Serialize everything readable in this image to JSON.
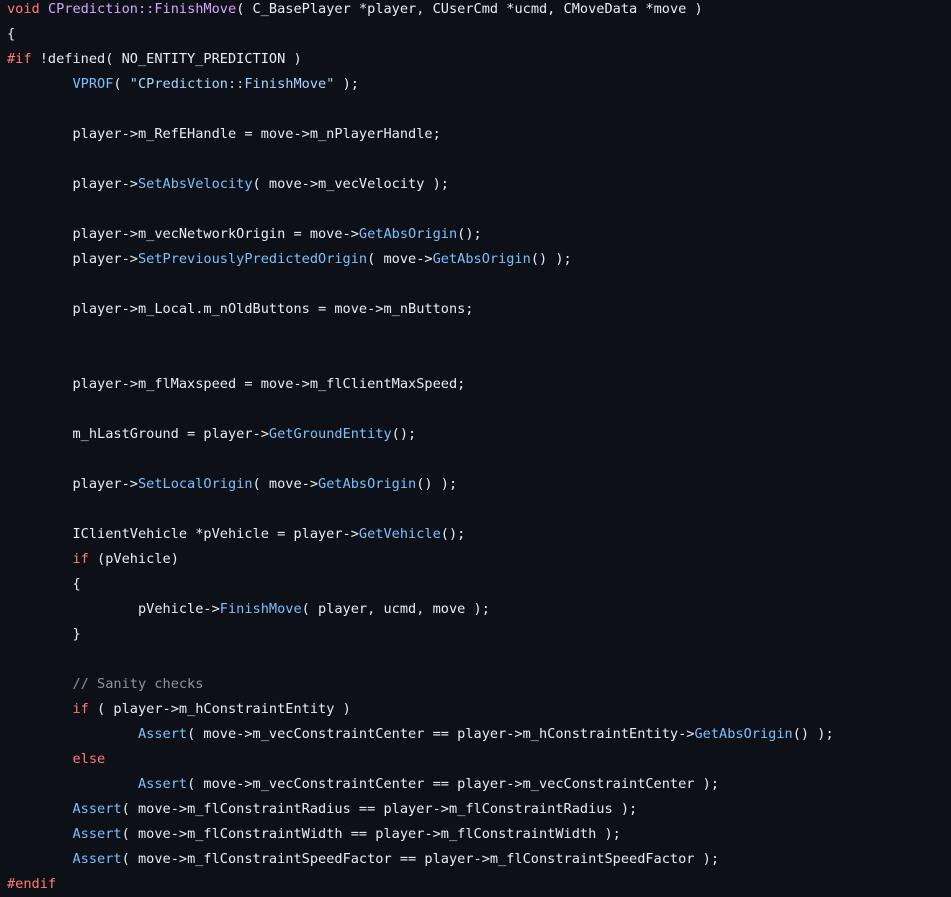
{
  "colors": {
    "background": "#0d1117",
    "text": "#e6edf3",
    "keyword": "#ff7b72",
    "function_def": "#d2a8ff",
    "function_call": "#79c0ff",
    "string": "#a5d6ff",
    "comment": "#8b949e"
  },
  "code_lines": [
    [
      [
        "kw",
        "void"
      ],
      [
        "plain",
        " "
      ],
      [
        "fn",
        "CPrediction::FinishMove"
      ],
      [
        "plain",
        "( C_BasePlayer *player, CUserCmd *ucmd, CMoveData *move )"
      ]
    ],
    [
      [
        "plain",
        "{"
      ]
    ],
    [
      [
        "pp",
        "#if"
      ],
      [
        "plain",
        " !defined( NO_ENTITY_PREDICTION )"
      ]
    ],
    [
      [
        "plain",
        "        "
      ],
      [
        "call",
        "VPROF"
      ],
      [
        "plain",
        "( "
      ],
      [
        "str",
        "\"CPrediction::FinishMove\""
      ],
      [
        "plain",
        " );"
      ]
    ],
    [],
    [
      [
        "plain",
        "        player->m_RefEHandle = move->m_nPlayerHandle;"
      ]
    ],
    [],
    [
      [
        "plain",
        "        player->"
      ],
      [
        "call",
        "SetAbsVelocity"
      ],
      [
        "plain",
        "( move->m_vecVelocity );"
      ]
    ],
    [],
    [
      [
        "plain",
        "        player->m_vecNetworkOrigin = move->"
      ],
      [
        "call",
        "GetAbsOrigin"
      ],
      [
        "plain",
        "();"
      ]
    ],
    [
      [
        "plain",
        "        player->"
      ],
      [
        "call",
        "SetPreviouslyPredictedOrigin"
      ],
      [
        "plain",
        "( move->"
      ],
      [
        "call",
        "GetAbsOrigin"
      ],
      [
        "plain",
        "() );"
      ]
    ],
    [],
    [
      [
        "plain",
        "        player->m_Local.m_nOldButtons = move->m_nButtons;"
      ]
    ],
    [],
    [],
    [
      [
        "plain",
        "        player->m_flMaxspeed = move->m_flClientMaxSpeed;"
      ]
    ],
    [],
    [
      [
        "plain",
        "        m_hLastGround = player->"
      ],
      [
        "call",
        "GetGroundEntity"
      ],
      [
        "plain",
        "();"
      ]
    ],
    [],
    [
      [
        "plain",
        "        player->"
      ],
      [
        "call",
        "SetLocalOrigin"
      ],
      [
        "plain",
        "( move->"
      ],
      [
        "call",
        "GetAbsOrigin"
      ],
      [
        "plain",
        "() );"
      ]
    ],
    [],
    [
      [
        "plain",
        "        IClientVehicle *pVehicle = player->"
      ],
      [
        "call",
        "GetVehicle"
      ],
      [
        "plain",
        "();"
      ]
    ],
    [
      [
        "plain",
        "        "
      ],
      [
        "kw",
        "if"
      ],
      [
        "plain",
        " (pVehicle)"
      ]
    ],
    [
      [
        "plain",
        "        {"
      ]
    ],
    [
      [
        "plain",
        "                pVehicle->"
      ],
      [
        "call",
        "FinishMove"
      ],
      [
        "plain",
        "( player, ucmd, move );"
      ]
    ],
    [
      [
        "plain",
        "        }"
      ]
    ],
    [],
    [
      [
        "plain",
        "        "
      ],
      [
        "cm",
        "// Sanity checks"
      ]
    ],
    [
      [
        "plain",
        "        "
      ],
      [
        "kw",
        "if"
      ],
      [
        "plain",
        " ( player->m_hConstraintEntity )"
      ]
    ],
    [
      [
        "plain",
        "                "
      ],
      [
        "call",
        "Assert"
      ],
      [
        "plain",
        "( move->m_vecConstraintCenter == player->m_hConstraintEntity->"
      ],
      [
        "call",
        "GetAbsOrigin"
      ],
      [
        "plain",
        "() );"
      ]
    ],
    [
      [
        "plain",
        "        "
      ],
      [
        "kw",
        "else"
      ]
    ],
    [
      [
        "plain",
        "                "
      ],
      [
        "call",
        "Assert"
      ],
      [
        "plain",
        "( move->m_vecConstraintCenter == player->m_vecConstraintCenter );"
      ]
    ],
    [
      [
        "plain",
        "        "
      ],
      [
        "call",
        "Assert"
      ],
      [
        "plain",
        "( move->m_flConstraintRadius == player->m_flConstraintRadius );"
      ]
    ],
    [
      [
        "plain",
        "        "
      ],
      [
        "call",
        "Assert"
      ],
      [
        "plain",
        "( move->m_flConstraintWidth == player->m_flConstraintWidth );"
      ]
    ],
    [
      [
        "plain",
        "        "
      ],
      [
        "call",
        "Assert"
      ],
      [
        "plain",
        "( move->m_flConstraintSpeedFactor == player->m_flConstraintSpeedFactor );"
      ]
    ],
    [
      [
        "pp",
        "#endif"
      ]
    ]
  ]
}
